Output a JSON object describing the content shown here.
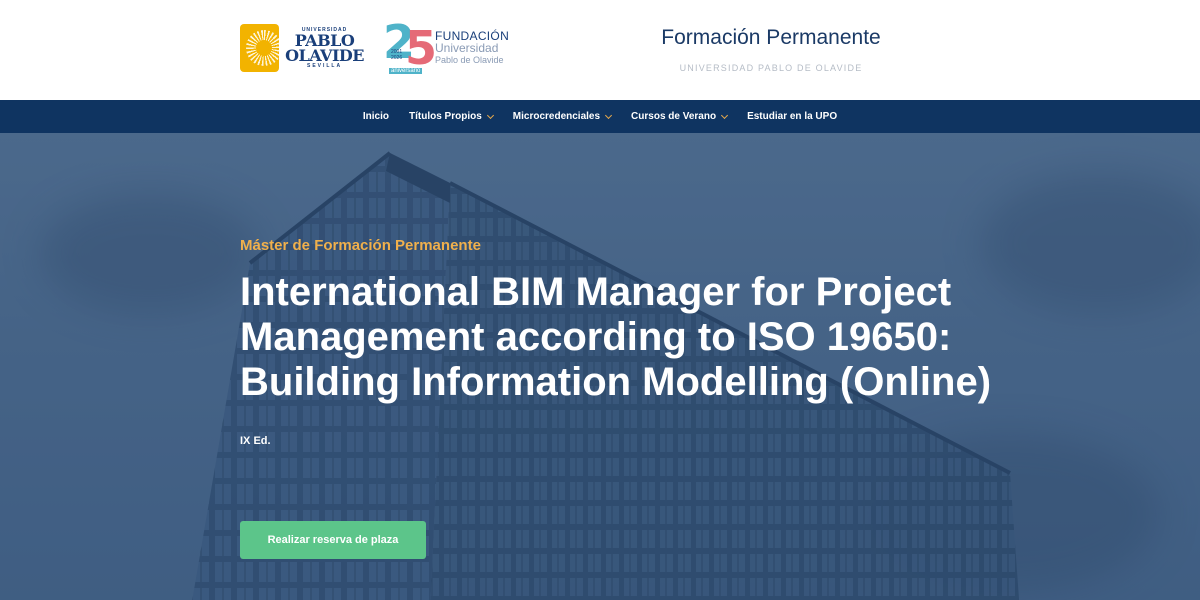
{
  "header": {
    "upo_logo": {
      "top": "UNIVERSIDAD",
      "line1": "PABLO",
      "line2": "OLAVIDE",
      "city": "SEVILLA"
    },
    "fundacion_logo": {
      "numerals": [
        "2",
        "5"
      ],
      "years": [
        "2001",
        "2026"
      ],
      "anniversary": "aniversario",
      "line1": "FUNDACIÓN",
      "line2": "Universidad",
      "line3": "Pablo de Olavide"
    },
    "brand_title": "Formación Permanente",
    "brand_subtitle": "UNIVERSIDAD PABLO DE OLAVIDE"
  },
  "nav": {
    "items": [
      {
        "label": "Inicio",
        "has_dropdown": false
      },
      {
        "label": "Títulos Propios",
        "has_dropdown": true
      },
      {
        "label": "Microcredenciales",
        "has_dropdown": true
      },
      {
        "label": "Cursos de Verano",
        "has_dropdown": true
      },
      {
        "label": "Estudiar en la UPO",
        "has_dropdown": false
      }
    ]
  },
  "hero": {
    "eyebrow": "Máster de Formación Permanente",
    "title": "International BIM Manager for Project Management according to ISO 19650: Building Information Modelling (Online)",
    "edition": "IX Ed.",
    "cta_label": "Realizar reserva de plaza"
  },
  "colors": {
    "nav_bg": "#0f3461",
    "accent": "#f0b04c",
    "cta": "#5cc58a",
    "brand_title": "#1b3a66"
  }
}
